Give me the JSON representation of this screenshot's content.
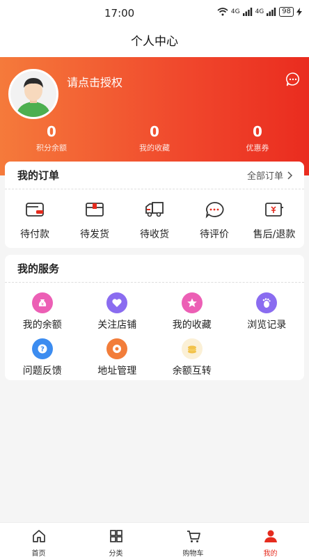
{
  "status": {
    "time": "17:00",
    "network1": "4G",
    "network2": "4G",
    "battery": "98"
  },
  "nav": {
    "title": "个人中心"
  },
  "profile": {
    "auth_text": "请点击授权"
  },
  "stats": [
    {
      "value": "0",
      "label": "积分余额"
    },
    {
      "value": "0",
      "label": "我的收藏"
    },
    {
      "value": "0",
      "label": "优惠券"
    }
  ],
  "orders": {
    "title": "我的订单",
    "more": "全部订单",
    "items": [
      {
        "label": "待付款",
        "icon": "wallet-icon"
      },
      {
        "label": "待发货",
        "icon": "package-icon"
      },
      {
        "label": "待收货",
        "icon": "truck-icon"
      },
      {
        "label": "待评价",
        "icon": "comment-icon"
      },
      {
        "label": "售后/退款",
        "icon": "refund-icon"
      }
    ]
  },
  "services": {
    "title": "我的服务",
    "items": [
      {
        "label": "我的余额",
        "icon": "money-bag-icon",
        "color": "#ec5fb5"
      },
      {
        "label": "关注店铺",
        "icon": "heart-icon",
        "color": "#8a6cf0"
      },
      {
        "label": "我的收藏",
        "icon": "star-icon",
        "color": "#ec5fb5"
      },
      {
        "label": "浏览记录",
        "icon": "footprint-icon",
        "color": "#8a6cf0"
      },
      {
        "label": "问题反馈",
        "icon": "question-icon",
        "color": "#3c8cf0"
      },
      {
        "label": "地址管理",
        "icon": "location-icon",
        "color": "#f27d3a"
      },
      {
        "label": "余额互转",
        "icon": "coins-icon",
        "color": "#f2c24a"
      }
    ]
  },
  "tabs": [
    {
      "label": "首页",
      "icon": "home-icon"
    },
    {
      "label": "分类",
      "icon": "grid-icon"
    },
    {
      "label": "购物车",
      "icon": "cart-icon"
    },
    {
      "label": "我的",
      "icon": "user-icon"
    }
  ],
  "colors": {
    "accent": "#e52b1e",
    "hero_start": "#f57a3b",
    "hero_end": "#ea2c1f"
  }
}
